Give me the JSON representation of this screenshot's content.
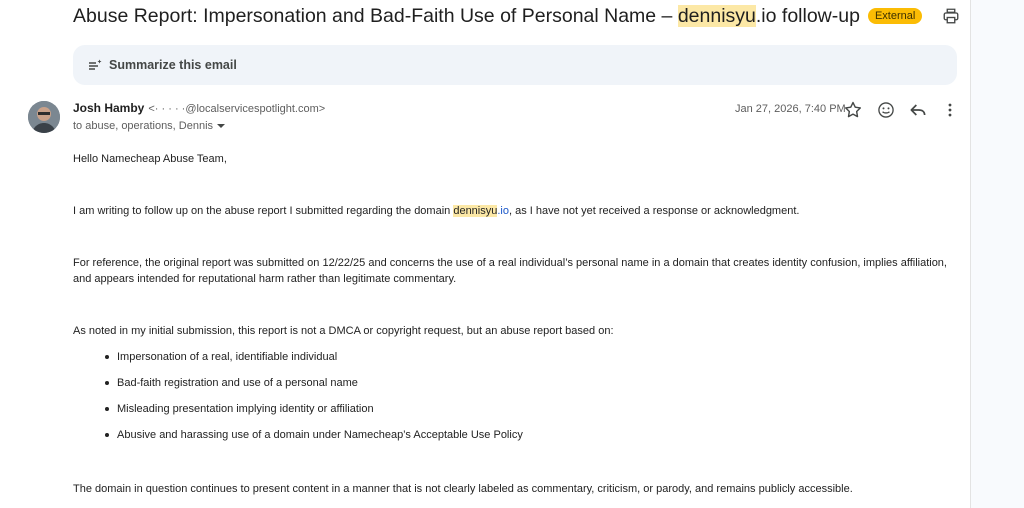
{
  "email": {
    "subject_prefix": "Abuse Report: Impersonation and Bad-Faith Use of Personal Name – ",
    "subject_highlight": "dennisyu",
    "subject_suffix": ".io follow-up",
    "external_badge": "External",
    "summarize_label": "Summarize this email",
    "sender_name": "Josh Hamby",
    "sender_email": "<·  ·   ·   ·  ·@localservicespotlight.com>",
    "recipients": "to abuse, operations, Dennis",
    "date": "Jan 27, 2026, 7:40 PM",
    "body": {
      "greeting": "Hello Namecheap Abuse Team,",
      "p1_before": "I am writing to follow up on the abuse report I submitted regarding the domain ",
      "p1_link_highlight": "dennisyu",
      "p1_link_rest": ".io",
      "p1_after": ", as I have not yet received a response or acknowledgment.",
      "p2": "For reference, the original report was submitted on 12/22/25 and concerns the use of a real individual’s personal name in a domain that creates identity confusion, implies affiliation, and appears intended for reputational harm rather than legitimate commentary.",
      "p3": "As noted in my initial submission, this report is not a DMCA or copyright request, but an abuse report based on:",
      "bullets": [
        "Impersonation of a real, identifiable individual",
        "Bad-faith registration and use of a personal name",
        "Misleading presentation implying identity or affiliation",
        "Abusive and harassing use of a domain under Namecheap’s Acceptable Use Policy"
      ],
      "p4": "The domain in question continues to present content in a manner that is not clearly labeled as commentary, criticism, or parody, and remains publicly accessible."
    }
  },
  "icons": {
    "print": "print-icon",
    "star": "star-icon",
    "emoji": "emoji-icon",
    "reply": "reply-icon",
    "more": "more-vert-icon",
    "summarize": "summarize-sparkle-icon",
    "caret": "chevron-down-icon"
  }
}
